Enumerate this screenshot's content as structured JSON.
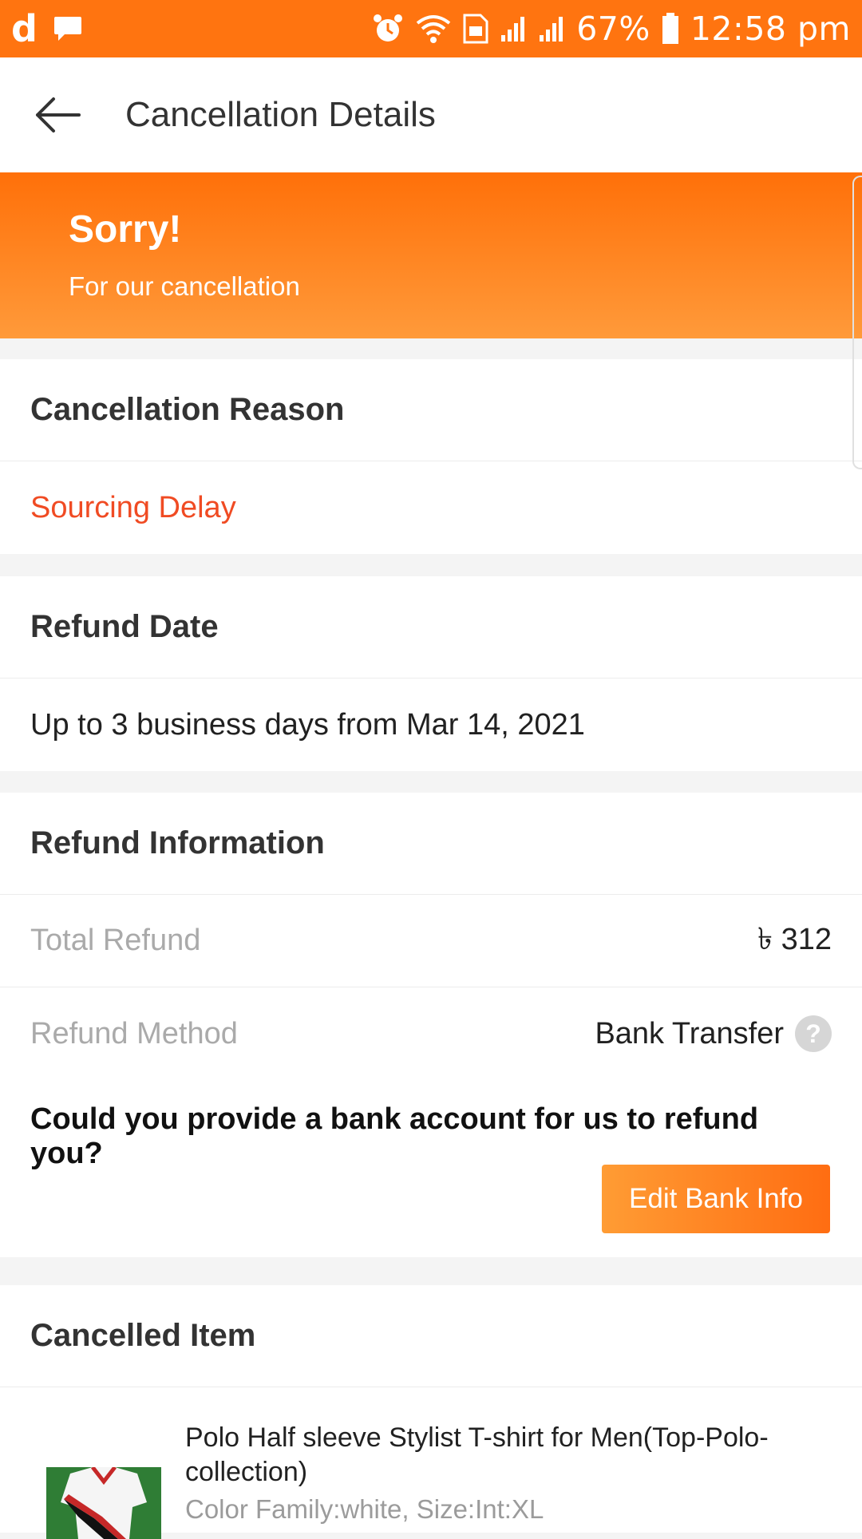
{
  "status_bar": {
    "app_letter": "d",
    "battery": "67%",
    "time": "12:58 pm",
    "icons": [
      "app-d-icon",
      "chat-icon",
      "alarm-icon",
      "wifi-icon",
      "sim-icon",
      "signal-icon",
      "signal-icon",
      "battery-icon"
    ]
  },
  "header": {
    "title": "Cancellation Details"
  },
  "banner": {
    "title": "Sorry!",
    "subtitle": "For our cancellation"
  },
  "reason": {
    "heading": "Cancellation Reason",
    "value": "Sourcing Delay",
    "value_color": "#f04b23"
  },
  "refund_date": {
    "heading": "Refund Date",
    "value": "Up to 3 business days from Mar 14, 2021"
  },
  "refund_info": {
    "heading": "Refund Information",
    "total_label": "Total Refund",
    "total_value": "৳ 312",
    "method_label": "Refund Method",
    "method_value": "Bank Transfer",
    "help_glyph": "?",
    "question": "Could you provide a bank account for us to refund you?",
    "edit_button": "Edit Bank Info"
  },
  "cancelled_item": {
    "heading": "Cancelled Item",
    "name": "Polo Half sleeve Stylist T-shirt for Men(Top-Polo-collection)",
    "attributes": "Color Family:white, Size:Int:XL"
  },
  "colors": {
    "accent": "#ff7410",
    "reason": "#f04b23"
  }
}
